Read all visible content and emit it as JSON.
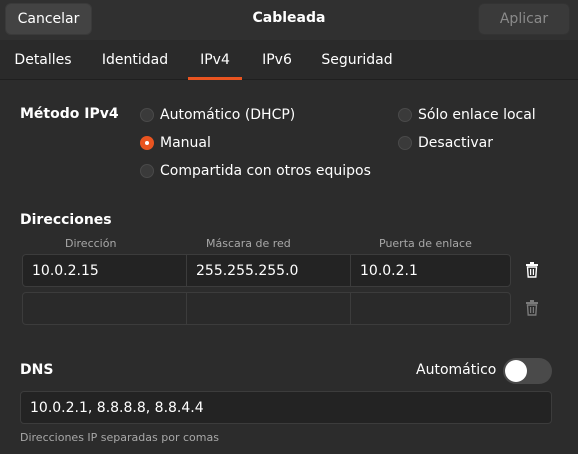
{
  "header": {
    "cancel_label": "Cancelar",
    "title": "Cableada",
    "apply_label": "Aplicar"
  },
  "tabs": [
    {
      "label": "Detalles",
      "active": false
    },
    {
      "label": "Identidad",
      "active": false
    },
    {
      "label": "IPv4",
      "active": true
    },
    {
      "label": "IPv6",
      "active": false
    },
    {
      "label": "Seguridad",
      "active": false
    }
  ],
  "ipv4": {
    "method_label": "Método IPv4",
    "methods": [
      {
        "label": "Automático (DHCP)",
        "checked": false
      },
      {
        "label": "Manual",
        "checked": true
      },
      {
        "label": "Compartida con otros equipos",
        "checked": false
      },
      {
        "label": "Sólo enlace local",
        "checked": false
      },
      {
        "label": "Desactivar",
        "checked": false
      }
    ]
  },
  "addresses": {
    "section_label": "Direcciones",
    "columns": [
      "Dirección",
      "Máscara de red",
      "Puerta de enlace"
    ],
    "rows": [
      [
        "10.0.2.15",
        "255.255.255.0",
        "10.0.2.1"
      ],
      [
        "",
        "",
        ""
      ]
    ]
  },
  "dns": {
    "section_label": "DNS",
    "auto_label": "Automático",
    "auto_enabled": false,
    "value": "10.0.2.1, 8.8.8.8, 8.8.4.4",
    "hint": "Direcciones IP separadas por comas"
  },
  "colors": {
    "accent": "#e95420",
    "background": "#2c2c2c"
  }
}
